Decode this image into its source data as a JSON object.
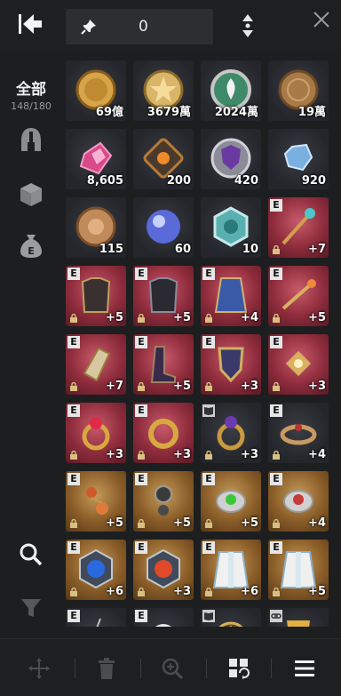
{
  "header": {
    "pinned_count": "0"
  },
  "sidebar": {
    "all_label": "全部",
    "all_count": "148/180"
  },
  "items": [
    {
      "bg": "dark",
      "type": "coin-gold",
      "qty": "69億"
    },
    {
      "bg": "dark",
      "type": "coin-star",
      "qty": "3679萬"
    },
    {
      "bg": "dark",
      "type": "coin-green",
      "qty": "2024萬"
    },
    {
      "bg": "dark",
      "type": "coin-bronze",
      "qty": "19萬"
    },
    {
      "bg": "dark",
      "type": "gem-pink",
      "qty": "8,605"
    },
    {
      "bg": "dark",
      "type": "rune-orange",
      "qty": "200"
    },
    {
      "bg": "dark",
      "type": "shield-purple",
      "qty": "420"
    },
    {
      "bg": "dark",
      "type": "crystal-blue",
      "qty": "920"
    },
    {
      "bg": "dark",
      "type": "coin-copper",
      "qty": "115"
    },
    {
      "bg": "dark",
      "type": "orb-blue",
      "qty": "60"
    },
    {
      "bg": "dark",
      "type": "badge-teal",
      "qty": "10"
    },
    {
      "bg": "red",
      "type": "staff",
      "qty": "+7",
      "e": "E",
      "lock": true
    },
    {
      "bg": "red",
      "type": "armor-dark",
      "qty": "+5",
      "e": "E",
      "lock": true
    },
    {
      "bg": "red",
      "type": "armor-black",
      "qty": "+5",
      "e": "E",
      "lock": true
    },
    {
      "bg": "red",
      "type": "cape-blue",
      "qty": "+4",
      "e": "E",
      "lock": true
    },
    {
      "bg": "red",
      "type": "wand-gold",
      "qty": "+5",
      "e": "E",
      "lock": true
    },
    {
      "bg": "red",
      "type": "gauntlet",
      "qty": "+7",
      "e": "E",
      "lock": true
    },
    {
      "bg": "red",
      "type": "boots",
      "qty": "+5",
      "e": "E",
      "lock": true
    },
    {
      "bg": "red",
      "type": "shield-gold",
      "qty": "+3",
      "e": "E",
      "lock": true
    },
    {
      "bg": "red",
      "type": "amulet-gold",
      "qty": "+3",
      "e": "E",
      "lock": true
    },
    {
      "bg": "red",
      "type": "ring-ruby",
      "qty": "+3",
      "e": "E",
      "lock": true
    },
    {
      "bg": "red",
      "type": "ring-gold",
      "qty": "+3",
      "e": "E",
      "lock": true
    },
    {
      "bg": "dark",
      "type": "ring-purple",
      "qty": "+3",
      "e": "book",
      "lock": true
    },
    {
      "bg": "dark",
      "type": "circlet",
      "qty": "+4",
      "e": "E",
      "lock": true
    },
    {
      "bg": "gold",
      "type": "earring-orange",
      "qty": "+5",
      "e": "E",
      "lock": true
    },
    {
      "bg": "gold",
      "type": "earring-dark",
      "qty": "+5",
      "e": "E",
      "lock": true
    },
    {
      "bg": "gold",
      "type": "bracer-green",
      "qty": "+5",
      "e": "E",
      "lock": true
    },
    {
      "bg": "gold",
      "type": "bracer-red",
      "qty": "+4",
      "e": "E",
      "lock": true
    },
    {
      "bg": "gold",
      "type": "emblem-blue",
      "qty": "+6",
      "e": "E",
      "lock": true
    },
    {
      "bg": "gold",
      "type": "emblem-red",
      "qty": "+3",
      "e": "E",
      "lock": true
    },
    {
      "bg": "gold",
      "type": "robe-white",
      "qty": "+6",
      "e": "E",
      "lock": true
    },
    {
      "bg": "gold",
      "type": "robe-white2",
      "qty": "+5",
      "e": "E",
      "lock": true
    },
    {
      "bg": "dark",
      "type": "pendant-blue",
      "qty": "",
      "e": "E",
      "lock": false
    },
    {
      "bg": "dark",
      "type": "orb-white",
      "qty": "",
      "e": "E",
      "lock": false
    },
    {
      "bg": "dark",
      "type": "compass",
      "qty": "",
      "e": "book",
      "lock": false
    },
    {
      "bg": "dark",
      "type": "trophy",
      "qty": "",
      "e": "link",
      "lock": false
    }
  ]
}
